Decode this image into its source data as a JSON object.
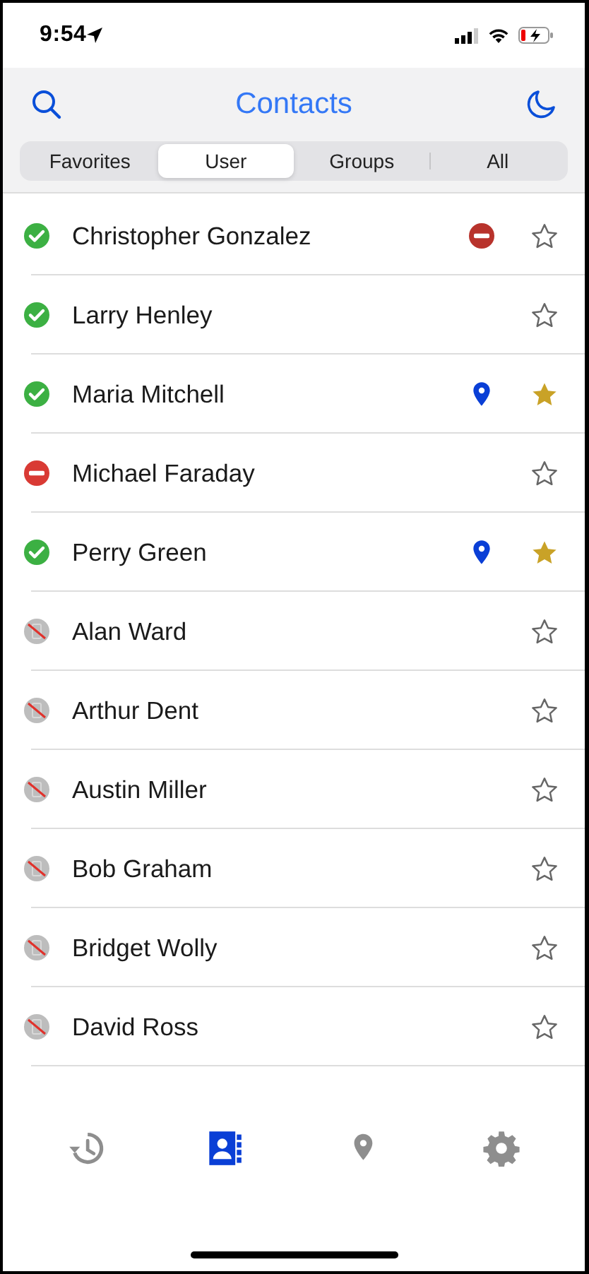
{
  "status_bar": {
    "time": "9:54"
  },
  "header": {
    "title": "Contacts"
  },
  "segments": [
    {
      "label": "Favorites",
      "selected": false
    },
    {
      "label": "User",
      "selected": true
    },
    {
      "label": "Groups",
      "selected": false
    },
    {
      "label": "All",
      "selected": false
    }
  ],
  "contacts": [
    {
      "name": "Christopher Gonzalez",
      "status": {
        "kind": "available"
      },
      "badge": {
        "kind": "busy"
      },
      "favorite": false
    },
    {
      "name": "Larry Henley",
      "status": {
        "kind": "available"
      },
      "favorite": false
    },
    {
      "name": "Maria Mitchell",
      "status": {
        "kind": "available"
      },
      "badge": {
        "kind": "location"
      },
      "favorite": true
    },
    {
      "name": "Michael Faraday",
      "status": {
        "kind": "busy"
      },
      "favorite": false
    },
    {
      "name": "Perry Green",
      "status": {
        "kind": "available"
      },
      "badge": {
        "kind": "location"
      },
      "favorite": true
    },
    {
      "name": "Alan Ward",
      "status": {
        "kind": "offline"
      },
      "favorite": false
    },
    {
      "name": "Arthur Dent",
      "status": {
        "kind": "offline"
      },
      "favorite": false
    },
    {
      "name": "Austin Miller",
      "status": {
        "kind": "offline"
      },
      "favorite": false
    },
    {
      "name": "Bob Graham",
      "status": {
        "kind": "offline"
      },
      "favorite": false
    },
    {
      "name": "Bridget Wolly",
      "status": {
        "kind": "offline"
      },
      "favorite": false
    },
    {
      "name": "David Ross",
      "status": {
        "kind": "offline"
      },
      "favorite": false
    }
  ],
  "tab_bar": [
    {
      "kind": "history",
      "selected": false
    },
    {
      "kind": "contacts",
      "selected": true
    },
    {
      "kind": "location",
      "selected": false
    },
    {
      "kind": "settings",
      "selected": false
    }
  ]
}
